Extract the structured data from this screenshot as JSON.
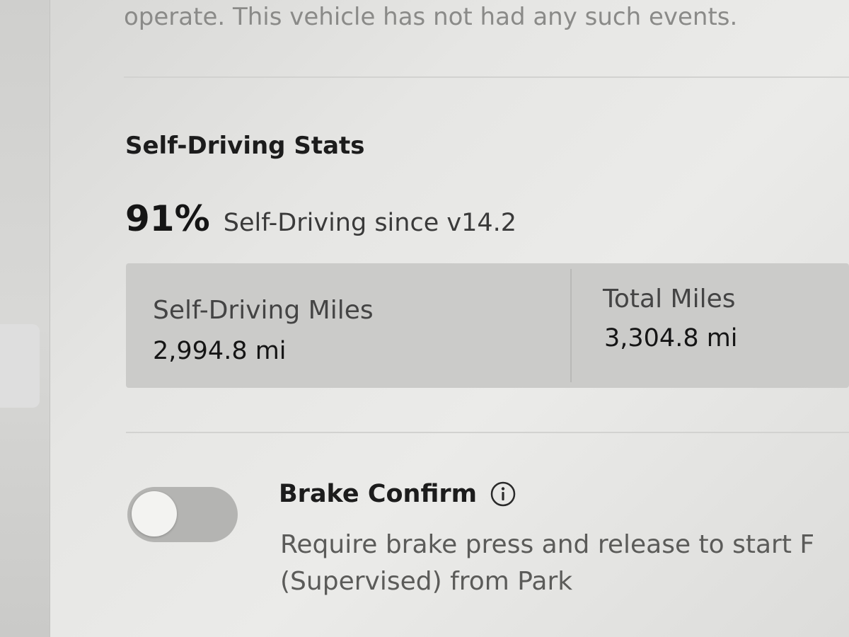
{
  "top_note": "operate. This vehicle has not had any such events.",
  "self_driving_stats": {
    "title": "Self-Driving Stats",
    "percent": "91%",
    "percent_caption": "Self-Driving since v14.2",
    "self_driving_miles": {
      "label": "Self-Driving Miles",
      "value": "2,994.8 mi"
    },
    "total_miles": {
      "label": "Total Miles",
      "value": "3,304.8 mi"
    }
  },
  "brake_confirm": {
    "title": "Brake Confirm",
    "enabled": false,
    "info_icon": "info-circle-icon",
    "description_line1": "Require brake press and release to start F",
    "description_line2": "(Supervised) from Park"
  },
  "colors": {
    "toggle_off_track": "#b4b4b2",
    "stats_box_bg": "#cbcbc9"
  }
}
